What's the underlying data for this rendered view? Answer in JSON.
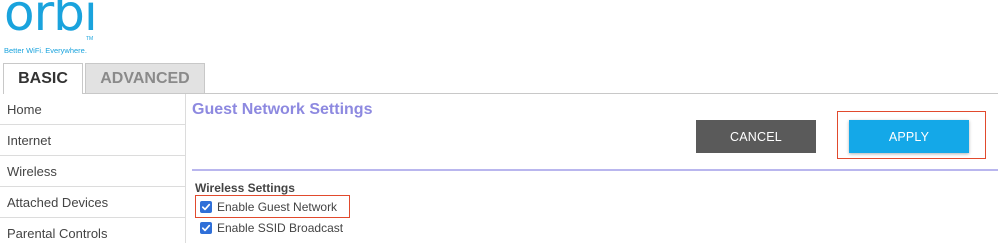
{
  "logo": {
    "word": "orbi",
    "tm": "TM",
    "tagline": "Better WiFi. Everywhere."
  },
  "tabs": [
    {
      "label": "BASIC",
      "active": true
    },
    {
      "label": "ADVANCED",
      "active": false
    }
  ],
  "sidebar": {
    "items": [
      {
        "label": "Home"
      },
      {
        "label": "Internet"
      },
      {
        "label": "Wireless"
      },
      {
        "label": "Attached Devices"
      },
      {
        "label": "Parental Controls"
      }
    ]
  },
  "main": {
    "title": "Guest Network Settings",
    "cancel_label": "CANCEL",
    "apply_label": "APPLY",
    "section_heading": "Wireless Settings",
    "options": [
      {
        "label": "Enable Guest Network",
        "checked": true
      },
      {
        "label": "Enable SSID Broadcast",
        "checked": true
      }
    ]
  },
  "colors": {
    "brand": "#1aa3dd",
    "title": "#8d89e0",
    "apply": "#14a8e8",
    "cancel": "#5a5a5a",
    "highlight": "#e14a2d",
    "checkbox": "#2f6fd8"
  },
  "icons": [
    "checkbox-checked-icon"
  ]
}
